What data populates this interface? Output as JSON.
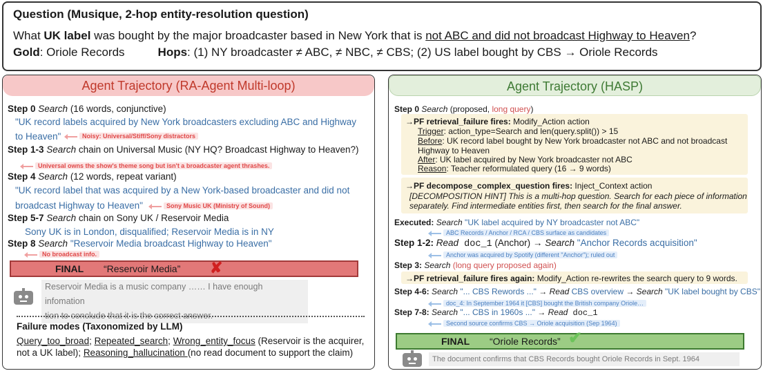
{
  "question": {
    "title": "Question (Musique, 2-hop entity-resolution question)",
    "text_pre": "What ",
    "text_bold": "UK label",
    "text_mid": " was bought by the major broadcaster based in New York that is ",
    "text_underline": "not ABC and did not broadcast Highway to Heaven",
    "text_end": "?",
    "gold_label": "Gold",
    "gold_value": ": Oriole Records",
    "hops_label": "Hops",
    "hops_value": ": (1) NY broadcaster ≠ ABC, ≠ NBC, ≠ CBS; (2) US label bought by CBS → Oriole Records"
  },
  "left": {
    "title": "Agent Trajectory (RA-Agent Multi-loop)",
    "s0_step": "Step 0",
    "s0_action": "Search",
    "s0_desc": " (16 words, conjunctive)",
    "s0_q1": "\"UK record labels acquired by New York broadcasters excluding ABC and Highway",
    "s0_q2": "to Heaven\"",
    "s0_note": "Noisy: Universal/Stiff/Sony distractors",
    "s1_step": "Step 1-3",
    "s1_action": "Search",
    "s1_desc": " chain on Universal Music (NY HQ? Broadcast Highway to Heaven?)",
    "s1_note": "Universal owns the show's theme song but isn't a broadcaster agent thrashes.",
    "s4_step": "Step 4",
    "s4_action": "Search",
    "s4_desc": " (12 words, repeat variant)",
    "s4_q1": "\"UK record label that was acquired by a New York-based broadcaster and did not",
    "s4_q2": "broadcast Highway to Heaven\"",
    "s4_note": "Sony Music UK (Ministry of Sound)",
    "s5_step": "Step 5-7",
    "s5_action": "Search",
    "s5_desc": " chain on Sony UK / Reservoir Media",
    "s5_sub": "Sony UK is in London, disqualified; Reservoir Media is in NY",
    "s8_step": "Step 8",
    "s8_action": "Search",
    "s8_q": " \"Reservoir Media broadcast Highway to Heaven\"",
    "s8_note": "No broadcast info.",
    "final_label": "FINAL",
    "final_value": "“Reservoir Media”",
    "reason_1": "Reservoir Media is a music company …… I have enough infomation",
    "reason_2": "tion to conclude that it is the correct answer.",
    "fail_title": "Failure modes (Taxonomized by LLM)",
    "fail_1": "Query_too_broad",
    "fail_2": "Repeated_search",
    "fail_3": "Wrong_entity_focus",
    "fail_3_note": " (Reservoir is the acquirer,",
    "fail_line2_pre": " not a UK label); ",
    "fail_4": "Reasoning_hallucination ",
    "fail_4_note": "(no read document to support the claim)"
  },
  "right": {
    "title": "Agent Trajectory (HASP)",
    "s0_step": "Step 0",
    "s0_action": "Search",
    "s0_proposed": " (proposed, ",
    "s0_long": "long query",
    "s0_close": ")",
    "pf1_title": "PF retrieval_failure fires:",
    "pf1_action": " Modify_Action action",
    "pf1_trigger_label": "Trigger",
    "pf1_trigger": ": action_type=Search and len(query.split()) > 15",
    "pf1_before_label": "Before",
    "pf1_before_1": ": UK record label bought by New York broadcaster not ABC and not broadcast",
    "pf1_before_2": "Highway to Heaven",
    "pf1_after_label": "After",
    "pf1_after": ": UK label acquired by New York broadcaster not ABC",
    "pf1_reason_label": "Reason",
    "pf1_reason": ": Teacher reformulated query (16 → 9 words)",
    "pf2_title": "PF decompose_complex_question fires:",
    "pf2_action": " Inject_Context action",
    "pf2_hint_1": "[DECOMPOSITION HINT] This is a multi-hop question. Search for each piece of information",
    "pf2_hint_2": "separately. Find intermediate entities first, then search for the final answer.",
    "exec_label": "Executed:",
    "exec_action": " Search",
    "exec_q": " \"UK label acquired by NY broadcaster not ABC\"",
    "exec_note": "ABC Records / Anchor / RCA / CBS surface as candidates",
    "s12_step": "Step 1-2:",
    "s12_read": " Read",
    "s12_doc": " doc_1",
    "s12_mid": " (Anchor) →",
    "s12_search": " Search",
    "s12_q": " \"Anchor Records acquisition\"",
    "s12_note": "Anchor was acquired by Spotify (different \"Anchor\"); ruled out",
    "s3_step": "Step 3:",
    "s3_action": " Search",
    "s3_long": " (long query proposed again)",
    "pf3_title": "PF retrieval_failure fires again:",
    "pf3_desc": " Modify_Action re-rewrites the search query to 9 words.",
    "s46_step": "Step 4-6:",
    "s46_a1": " Search",
    "s46_q1": " \"... CBS Rewords ...\"",
    "s46_a2": " → Read",
    "s46_q2": " CBS overview",
    "s46_a3": " → Search",
    "s46_q3": " \"UK label bought by CBS\"",
    "s46_note": "doc_4: In September 1964 it [CBS] bought the British company Oriole…",
    "s78_step": "Step 7-8:",
    "s78_a1": " Search",
    "s78_q1": " \"... CBS in 1960s ...\"",
    "s78_a2": " → Read",
    "s78_doc": " doc_1",
    "s78_note": "Second source confirms CBS → Oriole acquisition (Sep 1964)",
    "final_label": "FINAL",
    "final_value": "“Oriole Records”",
    "reason": "The document confirms that CBS Records bought Oriole Records in Sept. 1964"
  }
}
